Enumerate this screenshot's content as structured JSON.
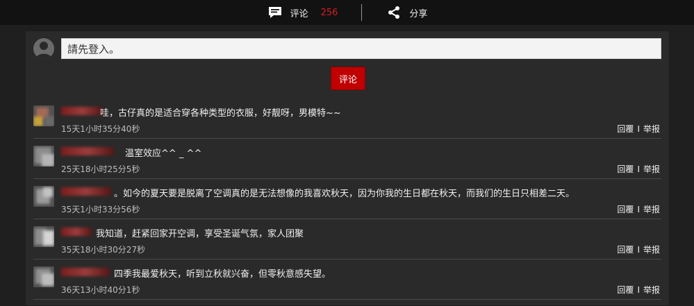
{
  "topbar": {
    "comment_label": "评论",
    "comment_count": "256",
    "share_label": "分享"
  },
  "login": {
    "placeholder": "請先登入。"
  },
  "submit": {
    "label": "评论"
  },
  "comments": [
    {
      "text": "哇，古仔真的是适合穿各种类型的衣服，好靓呀，男模特~~",
      "time": "15天1小时35分40秒",
      "reply": "回覆",
      "sep": "I",
      "report": "举报"
    },
    {
      "text": "温室效应^^ _ ^^",
      "time": "25天18小时25分5秒",
      "reply": "回覆",
      "sep": "I",
      "report": "举报"
    },
    {
      "text": "。如今的夏天要是脱离了空调真的是无法想像的我喜欢秋天，因为你我的生日都在秋天，而我们的生日只相差二天。",
      "time": "35天1小时33分56秒",
      "reply": "回覆",
      "sep": "I",
      "report": "举报"
    },
    {
      "text": "我知道，赶紧回家开空调，享受圣诞气氛，家人团聚",
      "time": "35天18小时30分27秒",
      "reply": "回覆",
      "sep": "I",
      "report": "举报"
    },
    {
      "text": "四季我最爱秋天，听到立秋就兴奋，但零秋意感失望。",
      "time": "36天13小时40分1秒",
      "reply": "回覆",
      "sep": "I",
      "report": "举报"
    }
  ],
  "colors": {
    "accent": "#c00000",
    "background": "#1f1f1f",
    "panel": "#2a2a2a",
    "count": "#d61f1f"
  }
}
